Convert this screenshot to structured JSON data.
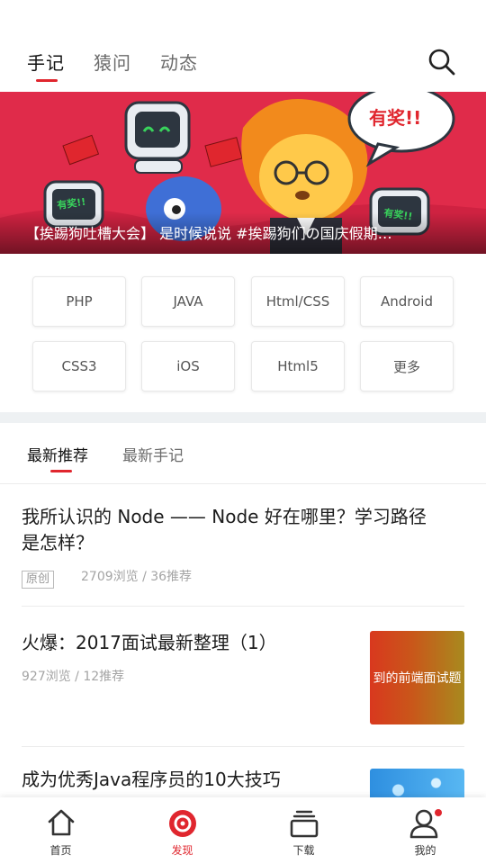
{
  "top_nav": {
    "tabs": [
      {
        "label": "手记",
        "active": true
      },
      {
        "label": "猿问",
        "active": false
      },
      {
        "label": "动态",
        "active": false
      }
    ],
    "search_icon": "search-icon"
  },
  "banner": {
    "caption": "【挨踢狗吐槽大会】 是时候说说 #挨踢狗们の国庆假期…",
    "bubble_text": "有奖!!",
    "robot_left_screen": "有奖!!",
    "robot_right_screen": "有奖!!"
  },
  "categories": [
    "PHP",
    "JAVA",
    "Html/CSS",
    "Android",
    "CSS3",
    "iOS",
    "Html5",
    "更多"
  ],
  "sub_tabs": [
    {
      "label": "最新推荐",
      "active": true
    },
    {
      "label": "最新手记",
      "active": false
    }
  ],
  "articles": [
    {
      "title_line1": "我所认识的 Node —— Node 好在哪里？学习路径",
      "title_line2": "是怎样？",
      "badge": "原创",
      "meta": "2709浏览 / 36推荐"
    },
    {
      "title": "火爆：2017面试最新整理（1）",
      "meta": "927浏览 / 12推荐",
      "thumb_text": "到的前端面试题"
    },
    {
      "title": "成为优秀Java程序员的10大技巧"
    }
  ],
  "bottom_nav": [
    {
      "label": "首页",
      "icon": "home-icon",
      "active": false
    },
    {
      "label": "发现",
      "icon": "discover-icon",
      "active": true
    },
    {
      "label": "下载",
      "icon": "download-icon",
      "active": false
    },
    {
      "label": "我的",
      "icon": "profile-icon",
      "active": false,
      "has_dot": true
    }
  ],
  "colors": {
    "accent": "#e0262e",
    "banner_bg": "#e02b4a"
  }
}
